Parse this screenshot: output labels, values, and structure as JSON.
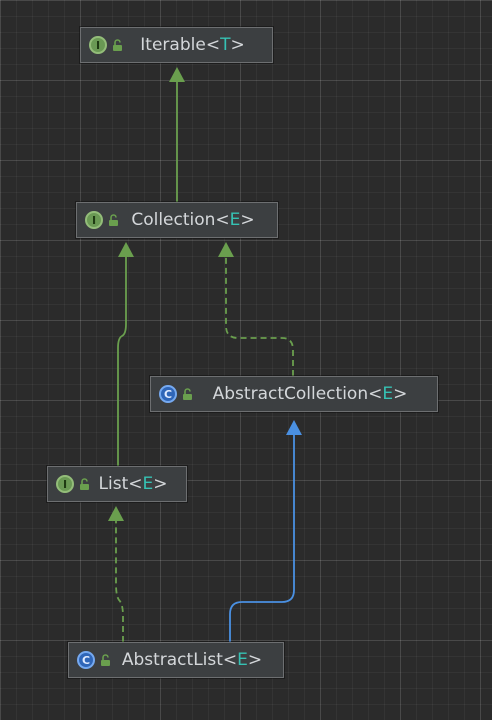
{
  "diagram": {
    "nodes": [
      {
        "id": "iterable",
        "name": "Iterable",
        "param": "T",
        "kind": "interface",
        "icon": "interface-icon",
        "access_icon": "public-lock-icon"
      },
      {
        "id": "collection",
        "name": "Collection",
        "param": "E",
        "kind": "interface",
        "icon": "interface-icon",
        "access_icon": "public-lock-icon"
      },
      {
        "id": "abstract_collection",
        "name": "AbstractCollection",
        "param": "E",
        "kind": "abstract-class",
        "icon": "class-icon",
        "access_icon": "public-lock-icon"
      },
      {
        "id": "list",
        "name": "List",
        "param": "E",
        "kind": "interface",
        "icon": "interface-icon",
        "access_icon": "public-lock-icon"
      },
      {
        "id": "abstract_list",
        "name": "AbstractList",
        "param": "E",
        "kind": "abstract-class",
        "icon": "class-icon",
        "access_icon": "public-lock-icon"
      }
    ],
    "edges": [
      {
        "from": "collection",
        "to": "iterable",
        "relation": "extends"
      },
      {
        "from": "list",
        "to": "collection",
        "relation": "extends"
      },
      {
        "from": "abstract_collection",
        "to": "collection",
        "relation": "implements"
      },
      {
        "from": "abstract_list",
        "to": "list",
        "relation": "implements"
      },
      {
        "from": "abstract_list",
        "to": "abstract_collection",
        "relation": "extends"
      }
    ],
    "colors": {
      "background": "#2b2b2b",
      "node_fill": "#3c3f41",
      "node_border": "#6d6f71",
      "text": "#d4d7da",
      "type_param": "#36c2b4",
      "interface_edge": "#6a9f4e",
      "class_edge": "#4a90e2"
    }
  }
}
